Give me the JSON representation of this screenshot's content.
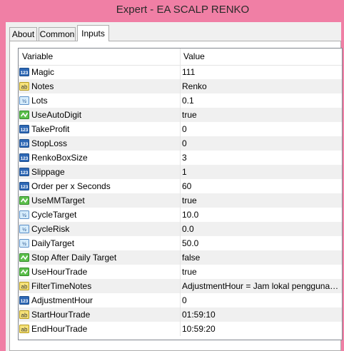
{
  "window": {
    "title": "Expert - EA SCALP RENKO"
  },
  "tabs": [
    {
      "label": "About"
    },
    {
      "label": "Common"
    },
    {
      "label": "Inputs"
    }
  ],
  "table": {
    "columns": {
      "variable": "Variable",
      "value": "Value"
    },
    "rows": [
      {
        "name": "Magic",
        "value": "111",
        "type": "int"
      },
      {
        "name": "Notes",
        "value": "Renko",
        "type": "string"
      },
      {
        "name": "Lots",
        "value": "0.1",
        "type": "double"
      },
      {
        "name": "UseAutoDigit",
        "value": "true",
        "type": "bool"
      },
      {
        "name": "TakeProfit",
        "value": "0",
        "type": "int"
      },
      {
        "name": "StopLoss",
        "value": "0",
        "type": "int"
      },
      {
        "name": "RenkoBoxSize",
        "value": "3",
        "type": "int"
      },
      {
        "name": "Slippage",
        "value": "1",
        "type": "int"
      },
      {
        "name": "Order per x Seconds",
        "value": "60",
        "type": "int"
      },
      {
        "name": "UseMMTarget",
        "value": "true",
        "type": "bool"
      },
      {
        "name": "CycleTarget",
        "value": "10.0",
        "type": "double"
      },
      {
        "name": "CycleRisk",
        "value": "0.0",
        "type": "double"
      },
      {
        "name": "DailyTarget",
        "value": "50.0",
        "type": "double"
      },
      {
        "name": "Stop After Daily Target",
        "value": "false",
        "type": "bool"
      },
      {
        "name": "UseHourTrade",
        "value": "true",
        "type": "bool"
      },
      {
        "name": "FilterTimeNotes",
        "value": "AdjustmentHour = Jam lokal pengguna dikur...",
        "type": "string"
      },
      {
        "name": "AdjustmentHour",
        "value": "0",
        "type": "int"
      },
      {
        "name": "StartHourTrade",
        "value": "01:59:10",
        "type": "string"
      },
      {
        "name": "EndHourTrade",
        "value": "10:59:20",
        "type": "string"
      }
    ]
  },
  "icons": {
    "int": "integer-type-icon",
    "string": "string-type-icon",
    "double": "double-type-icon",
    "bool": "boolean-type-icon"
  },
  "colors": {
    "titlebar": "#f07fa5",
    "row_alt": "#f0f0f0",
    "grid_border": "#828790"
  }
}
